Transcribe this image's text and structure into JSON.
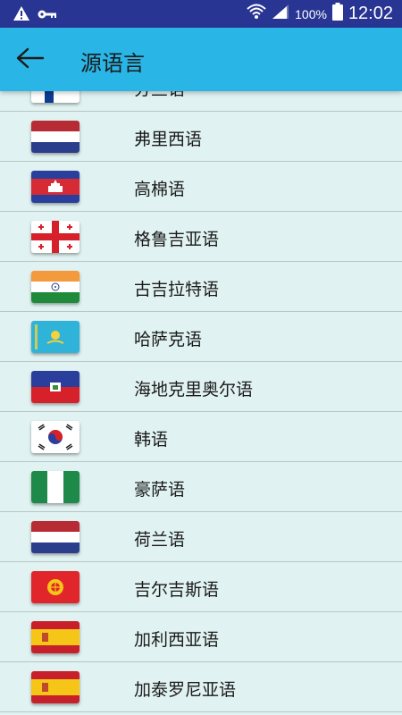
{
  "status_bar": {
    "battery_percent": "100%",
    "time": "12:02"
  },
  "app_bar": {
    "title": "源语言"
  },
  "languages": [
    {
      "label": "分兰语",
      "flag": "finland-flag-icon"
    },
    {
      "label": "弗里西语",
      "flag": "netherlands-flag-icon"
    },
    {
      "label": "高棉语",
      "flag": "cambodia-flag-icon"
    },
    {
      "label": "格鲁吉亚语",
      "flag": "georgia-flag-icon"
    },
    {
      "label": "古吉拉特语",
      "flag": "india-flag-icon"
    },
    {
      "label": "哈萨克语",
      "flag": "kazakhstan-flag-icon"
    },
    {
      "label": "海地克里奥尔语",
      "flag": "haiti-flag-icon"
    },
    {
      "label": "韩语",
      "flag": "south-korea-flag-icon"
    },
    {
      "label": "豪萨语",
      "flag": "nigeria-flag-icon"
    },
    {
      "label": "荷兰语",
      "flag": "netherlands-flag-icon"
    },
    {
      "label": "吉尔吉斯语",
      "flag": "kyrgyzstan-flag-icon"
    },
    {
      "label": "加利西亚语",
      "flag": "spain-flag-icon"
    },
    {
      "label": "加泰罗尼亚语",
      "flag": "spain-flag-icon"
    }
  ]
}
